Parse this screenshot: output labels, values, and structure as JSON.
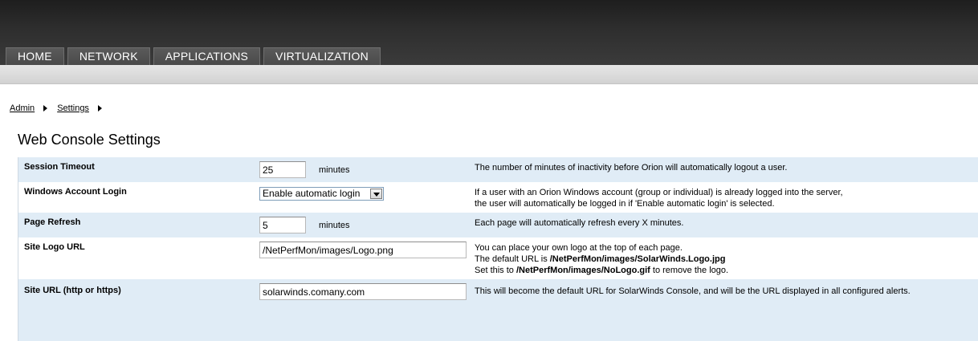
{
  "nav": {
    "tabs": [
      {
        "label": "HOME"
      },
      {
        "label": "NETWORK"
      },
      {
        "label": "APPLICATIONS"
      },
      {
        "label": "VIRTUALIZATION"
      }
    ]
  },
  "breadcrumb": {
    "items": [
      {
        "label": "Admin"
      },
      {
        "label": "Settings"
      }
    ]
  },
  "page": {
    "title": "Web Console Settings"
  },
  "settings": {
    "session_timeout": {
      "label": "Session Timeout",
      "value": "25",
      "unit": "minutes",
      "description": "The number of minutes of inactivity before Orion will automatically logout a user."
    },
    "windows_login": {
      "label": "Windows Account Login",
      "selected": "Enable automatic login",
      "description_line1": "If a user with an Orion Windows account (group or individual) is already logged into the server,",
      "description_line2": "the user will automatically be logged in if 'Enable automatic login' is selected."
    },
    "page_refresh": {
      "label": "Page Refresh",
      "value": "5",
      "unit": "minutes",
      "description": "Each page will automatically refresh every X minutes."
    },
    "site_logo": {
      "label": "Site Logo URL",
      "value": "/NetPerfMon/images/Logo.png",
      "description_line1": "You can place your own logo at the top of each page.",
      "description_line2_prefix": "The default URL is ",
      "description_line2_path": "/NetPerfMon/images/SolarWinds.Logo.jpg",
      "description_line3_prefix": "Set this to ",
      "description_line3_path": "/NetPerfMon/images/NoLogo.gif",
      "description_line3_suffix": " to remove the logo."
    },
    "site_url": {
      "label": "Site URL (http or https)",
      "value": "solarwinds.comany.com",
      "description": "This will become the default URL for SolarWinds Console, and will be the URL displayed in all configured alerts."
    }
  },
  "colors": {
    "header_dark": "#2e2e2e",
    "row_alt": "#e0ecf6",
    "subbar": "#dcdcdc"
  }
}
